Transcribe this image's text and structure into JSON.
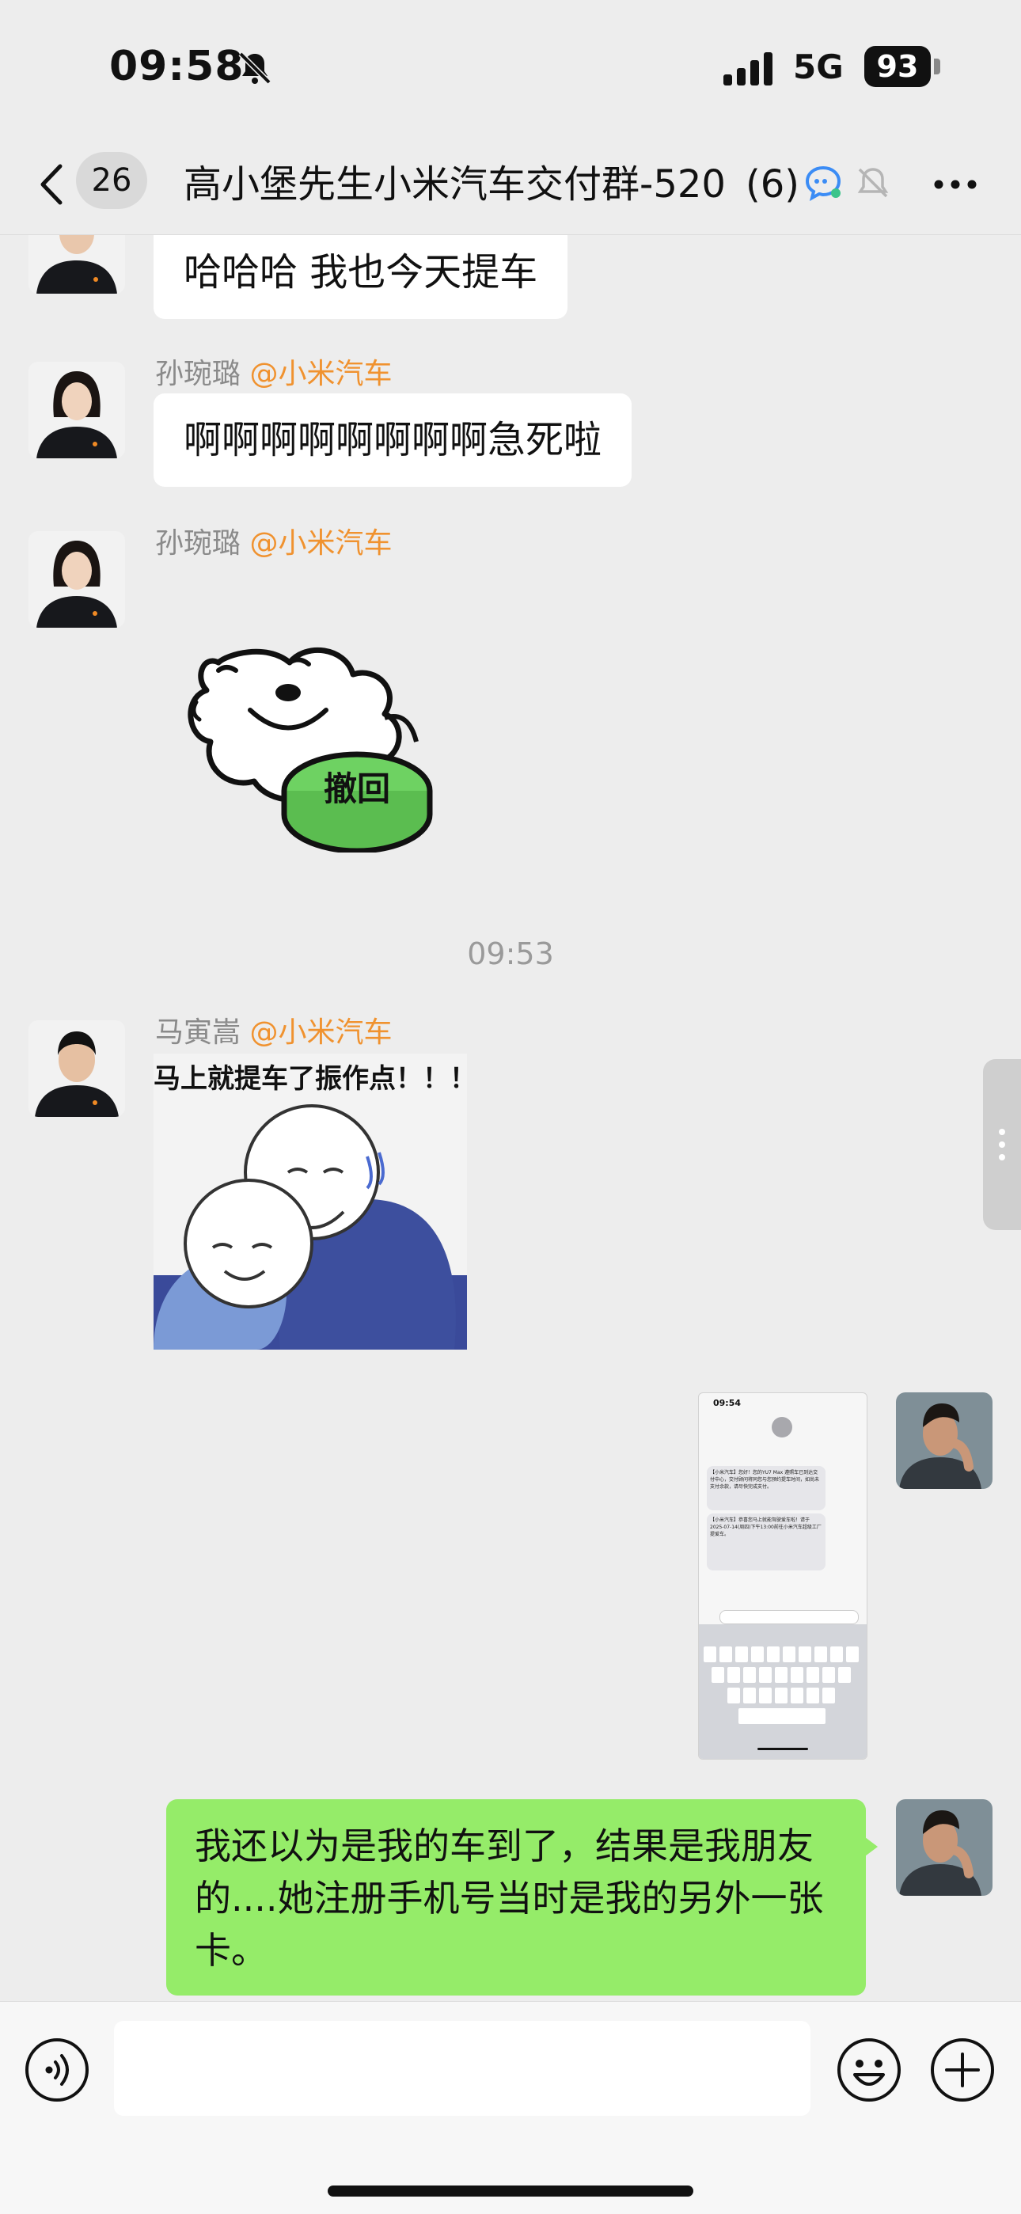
{
  "status_bar": {
    "time": "09:58",
    "network": "5G",
    "battery": "93"
  },
  "nav": {
    "unread_count": "26",
    "title": "高小堡先生小米汽车交付群-520",
    "member_count": "(6)"
  },
  "messages": [
    {
      "type": "text_in",
      "text": "哈哈哈 我也今天提车"
    },
    {
      "type": "text_in",
      "sender": "孙琬璐",
      "sender_tag": "@小米汽车",
      "text": "啊啊啊啊啊啊啊啊急死啦"
    },
    {
      "type": "sticker_in",
      "sender": "孙琬璐",
      "sender_tag": "@小米汽车",
      "sticker_text": "撤回"
    },
    {
      "type": "time",
      "text": "09:53"
    },
    {
      "type": "sticker_in",
      "sender": "马寅嵩",
      "sender_tag": "@小米汽车",
      "sticker_text": "马上就提车了振作点！！！"
    },
    {
      "type": "image_out",
      "thumb": {
        "time": "09:54",
        "sms1": "【小米汽车】您好！您的YU7 Max 遵照车已到达交付中心，交付顾问将同您与您预约提车时间，如尚未支付余款，请尽快完成支付。",
        "sms2": "【小米汽车】恭喜您马上就能驾驶爱车啦！请于2025-07-14(周四)下午13:00前往小米汽车超级工厂提爱车。"
      }
    },
    {
      "type": "text_out",
      "text": "我还以为是我的车到了，结果是我朋友的....她注册手机号当时是我的另外一张卡。"
    }
  ]
}
